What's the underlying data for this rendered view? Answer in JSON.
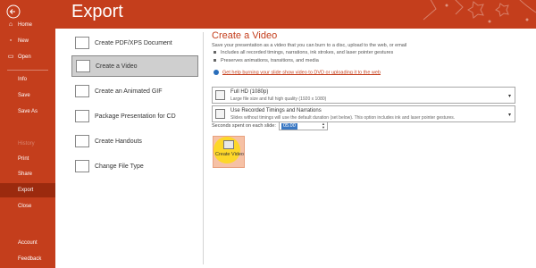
{
  "sidebar": {
    "items": [
      {
        "label": "Home",
        "icon": "home-icon"
      },
      {
        "label": "New",
        "icon": "new-file-icon"
      },
      {
        "label": "Open",
        "icon": "folder-icon"
      },
      {
        "label": "Info"
      },
      {
        "label": "Save"
      },
      {
        "label": "Save As"
      },
      {
        "label": "History"
      },
      {
        "label": "Print"
      },
      {
        "label": "Share"
      },
      {
        "label": "Export"
      },
      {
        "label": "Close"
      },
      {
        "label": "Account"
      },
      {
        "label": "Feedback"
      }
    ],
    "selected": "Export",
    "accent": "#c43e1c"
  },
  "header": {
    "title": "Export"
  },
  "options": [
    {
      "label": "Create PDF/XPS Document",
      "icon": "pdf-icon"
    },
    {
      "label": "Create a Video",
      "icon": "video-icon"
    },
    {
      "label": "Create an Animated GIF",
      "icon": "gif-icon"
    },
    {
      "label": "Package Presentation for CD",
      "icon": "cd-package-icon"
    },
    {
      "label": "Create Handouts",
      "icon": "handouts-icon"
    },
    {
      "label": "Change File Type",
      "icon": "file-type-icon"
    }
  ],
  "detail": {
    "title": "Create a Video",
    "description": "Save your presentation as a video that you can burn to a disc, upload to the web, or email",
    "bullets": [
      "Includes all recorded timings, narrations, ink strokes, and laser pointer gestures",
      "Preserves animations, transitions, and media"
    ],
    "help_link": "Get help burning your slide show video to DVD or uploading it to the web",
    "quality": {
      "main": "Full HD (1080p)",
      "sub": "Large file size and full high quality (1920 x 1080)"
    },
    "timings": {
      "main": "Use Recorded Timings and Narrations",
      "sub": "Slides without timings will use the default duration (set below). This option includes ink and laser pointer gestures."
    },
    "seconds_label": "Seconds spent on each slide:",
    "seconds_value": "05.00",
    "create_button": "Create Video"
  }
}
